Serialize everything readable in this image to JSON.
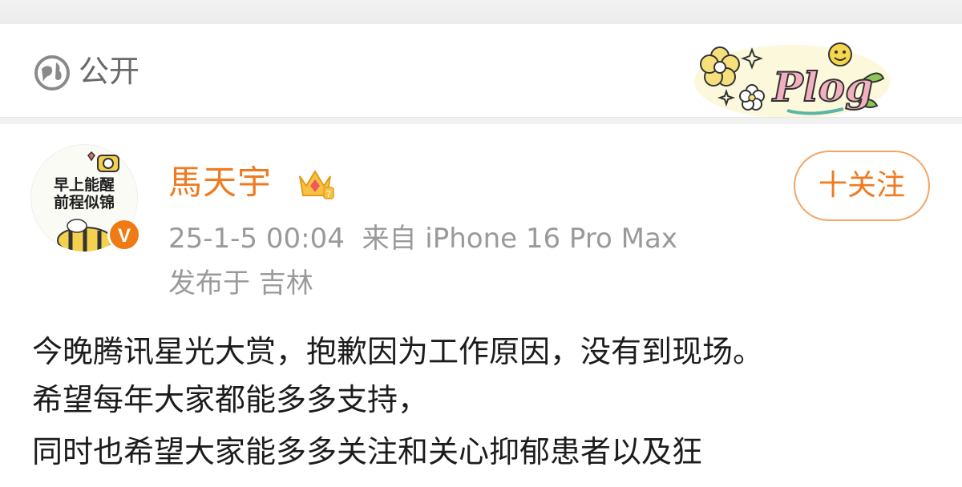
{
  "visibility": {
    "label": "公开",
    "icon": "globe-icon"
  },
  "badge": {
    "text": "Plog",
    "icon": "plog-sticker"
  },
  "author": {
    "avatar_text_line1": "早上能醒",
    "avatar_text_line2": "前程似锦",
    "verified_mark": "V",
    "name": "馬天宇",
    "name_color": "#ef7a20",
    "crown_icon": "crown-icon"
  },
  "follow": {
    "label": "十关注"
  },
  "meta": {
    "time_source": "25-1-5 00:04  来自 iPhone 16 Pro Max",
    "location": "发布于 吉林"
  },
  "post": {
    "lines": [
      "今晚腾讯星光大赏，抱歉因为工作原因，没有到现场。",
      "希望每年大家都能多多支持，",
      "同时也希望大家能多多关注和关心抑郁患者以及狂"
    ]
  }
}
